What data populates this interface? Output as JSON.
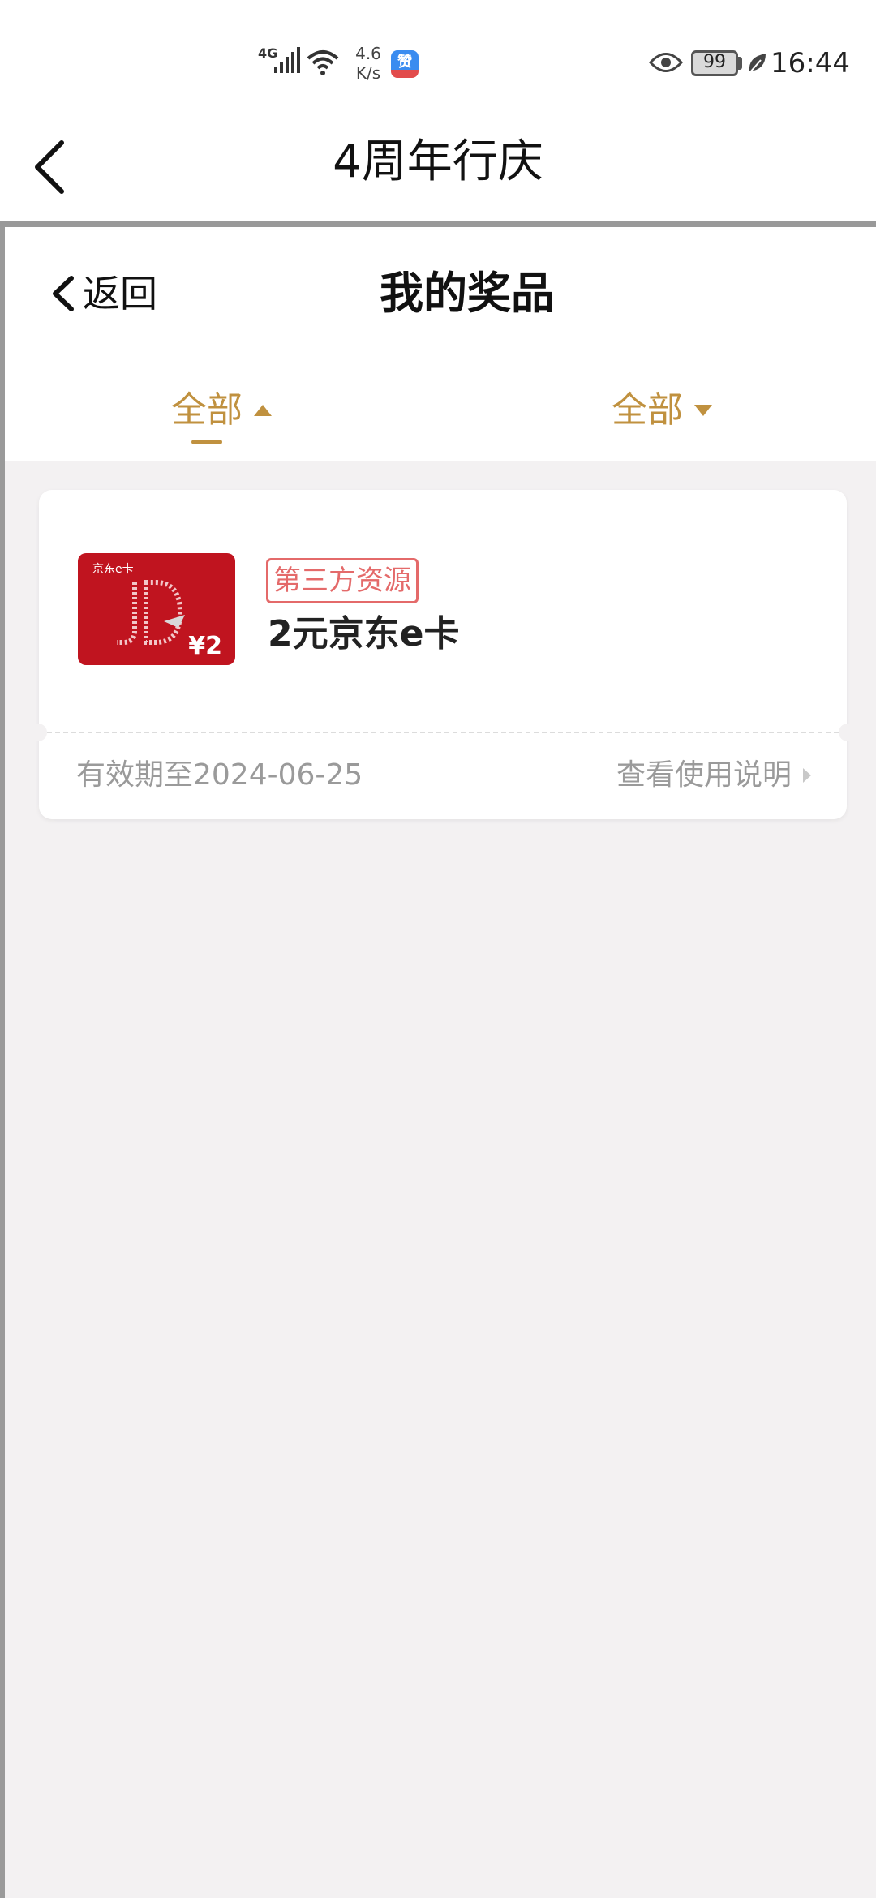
{
  "status_bar": {
    "signal_label": "4G",
    "net_speed": "4.6\nK/s",
    "app_badge": "赞",
    "battery": "99",
    "time": "16:44",
    "icons": [
      "signal-icon",
      "wifi-icon",
      "app-notification-icon",
      "eye-icon",
      "battery-icon",
      "leaf-icon"
    ]
  },
  "app_header": {
    "title": "4周年行庆",
    "back_icon": "chevron-left-icon"
  },
  "page_nav": {
    "back_label": "返回",
    "title": "我的奖品"
  },
  "filters": [
    {
      "label": "全部",
      "caret": "caret-up-icon",
      "active": true
    },
    {
      "label": "全部",
      "caret": "caret-down-icon",
      "active": false
    }
  ],
  "prizes": [
    {
      "image_brand": "京东e卡",
      "image_value": "¥2",
      "source_tag": "第三方资源",
      "name": "2元京东e卡",
      "expiry": "有效期至2024-06-25",
      "instructions_label": "查看使用说明"
    }
  ],
  "colors": {
    "accent": "#c0913f",
    "tag_red": "#e46a6a",
    "card_red": "#c0141f",
    "content_bg": "#f3f1f2"
  }
}
